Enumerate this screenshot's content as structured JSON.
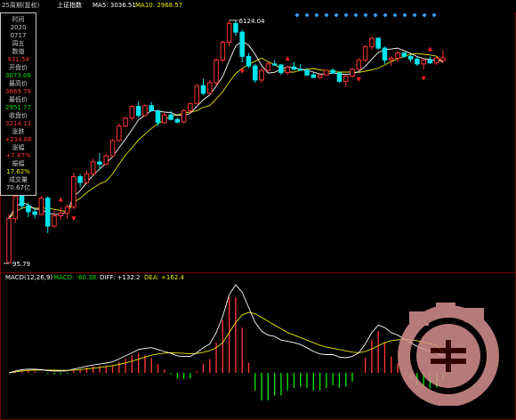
{
  "header": {
    "period": "25周期(复权)",
    "index_name": "上证指数",
    "ma5": "MA5: 3036.51",
    "ma10": "MA10: 2968.57"
  },
  "panel": {
    "time_label": "时间",
    "year": "2020",
    "date": "0717",
    "weekday": "周五",
    "value_label": "数值",
    "value": "931.54",
    "open_label": "开盘价",
    "open": "3073.08",
    "high_label": "最高价",
    "high": "3669.79",
    "low_label": "最低价",
    "low": "2951.77",
    "close_label": "收盘价",
    "close": "3214.13",
    "change_label": "涨跌",
    "change": "+234.88",
    "change_pct_label": "涨幅",
    "change_pct": "+7.87%",
    "amplitude_label": "振幅",
    "amplitude": "17.62%",
    "volume_label": "成交量",
    "volume": "70.67亿"
  },
  "macd": {
    "title": "MACD(12,26,9)",
    "macd": "MACD: -60.38",
    "diff": "DIFF: +132.2",
    "dea": "DEA: +162.4"
  },
  "annotations": {
    "high_label": "6124.04",
    "low_label": "95.79"
  },
  "colors": {
    "up": "#ff3232",
    "down": "#00e5ee",
    "ma5": "#ffffff",
    "ma10": "#e8e800",
    "diff": "#ffffff",
    "dea": "#e8e800",
    "hist_pos": "#ff3232",
    "hist_neg": "#00e000"
  },
  "chart_data": {
    "type": "candlestick",
    "price_range": [
      95,
      6200
    ],
    "ohlc": [
      [
        96,
        220,
        95,
        205
      ],
      [
        205,
        320,
        190,
        300
      ],
      [
        300,
        335,
        240,
        255
      ],
      [
        255,
        270,
        210,
        230
      ],
      [
        230,
        245,
        205,
        220
      ],
      [
        220,
        300,
        215,
        290
      ],
      [
        290,
        300,
        160,
        180
      ],
      [
        180,
        235,
        175,
        215
      ],
      [
        215,
        250,
        200,
        225
      ],
      [
        225,
        260,
        205,
        250
      ],
      [
        250,
        450,
        240,
        420
      ],
      [
        420,
        440,
        350,
        380
      ],
      [
        380,
        470,
        370,
        440
      ],
      [
        440,
        570,
        430,
        540
      ],
      [
        540,
        630,
        480,
        520
      ],
      [
        520,
        620,
        510,
        600
      ],
      [
        600,
        800,
        590,
        780
      ],
      [
        780,
        1050,
        760,
        1000
      ],
      [
        1000,
        1160,
        980,
        1150
      ],
      [
        1150,
        1430,
        1100,
        1400
      ],
      [
        1400,
        1520,
        1150,
        1200
      ],
      [
        1200,
        1450,
        1180,
        1420
      ],
      [
        1420,
        1510,
        1280,
        1300
      ],
      [
        1300,
        1330,
        1000,
        1060
      ],
      [
        1060,
        1250,
        1040,
        1210
      ],
      [
        1210,
        1300,
        1100,
        1120
      ],
      [
        1120,
        1150,
        1050,
        1070
      ],
      [
        1070,
        1340,
        1050,
        1300
      ],
      [
        1300,
        1480,
        1240,
        1470
      ],
      [
        1470,
        2050,
        1450,
        2000
      ],
      [
        2000,
        2250,
        1700,
        1750
      ],
      [
        1750,
        2200,
        1700,
        2100
      ],
      [
        2100,
        3200,
        2000,
        3100
      ],
      [
        3100,
        4300,
        3000,
        4200
      ],
      [
        4200,
        6124,
        3900,
        5800
      ],
      [
        5800,
        6100,
        4700,
        5000
      ],
      [
        5000,
        5200,
        2990,
        3300
      ],
      [
        3300,
        3500,
        2700,
        2800
      ],
      [
        2800,
        2900,
        2100,
        2200
      ],
      [
        2200,
        2700,
        2100,
        2600
      ],
      [
        2600,
        3000,
        2550,
        2900
      ],
      [
        2900,
        3100,
        2800,
        2850
      ],
      [
        2850,
        2900,
        2400,
        2500
      ],
      [
        2500,
        2800,
        2400,
        2750
      ],
      [
        2750,
        3000,
        2600,
        2650
      ],
      [
        2650,
        2900,
        2580,
        2600
      ],
      [
        2600,
        2700,
        2350,
        2400
      ],
      [
        2400,
        2500,
        2280,
        2300
      ],
      [
        2300,
        2450,
        2250,
        2400
      ],
      [
        2400,
        2650,
        2380,
        2600
      ],
      [
        2600,
        2700,
        2450,
        2480
      ],
      [
        2480,
        2550,
        2100,
        2150
      ],
      [
        2150,
        2400,
        1950,
        2350
      ],
      [
        2350,
        2700,
        2300,
        2650
      ],
      [
        2650,
        3200,
        2600,
        3100
      ],
      [
        3100,
        4000,
        3000,
        3900
      ],
      [
        3900,
        4600,
        3700,
        4500
      ],
      [
        4500,
        4600,
        3700,
        3800
      ],
      [
        3800,
        3900,
        2900,
        3100
      ],
      [
        3100,
        3300,
        2800,
        3200
      ],
      [
        3200,
        3600,
        3000,
        3500
      ],
      [
        3500,
        3550,
        3200,
        3300
      ],
      [
        3300,
        3400,
        3000,
        3150
      ],
      [
        3150,
        3300,
        2800,
        2900
      ],
      [
        2900,
        3200,
        2650,
        3100
      ],
      [
        3100,
        3300,
        2900,
        2950
      ],
      [
        2950,
        3250,
        2850,
        3200
      ],
      [
        3073,
        3670,
        2952,
        3214
      ]
    ],
    "ma5": [
      205,
      250,
      270,
      260,
      240,
      240,
      225,
      220,
      220,
      230,
      300,
      330,
      380,
      430,
      480,
      530,
      590,
      690,
      800,
      940,
      1110,
      1210,
      1300,
      1290,
      1270,
      1260,
      1200,
      1200,
      1240,
      1400,
      1570,
      1700,
      1990,
      2340,
      3060,
      3940,
      4280,
      4000,
      3420,
      2820,
      2480,
      2510,
      2650,
      2770,
      2700,
      2650,
      2610,
      2520,
      2440,
      2440,
      2480,
      2450,
      2420,
      2450,
      2540,
      2780,
      3150,
      3520,
      3700,
      3740,
      3800,
      3640,
      3480,
      3290,
      3180,
      3120,
      3090,
      3030
    ],
    "ma10": [
      205,
      230,
      245,
      250,
      245,
      245,
      245,
      240,
      235,
      230,
      270,
      290,
      320,
      345,
      370,
      390,
      440,
      520,
      610,
      690,
      790,
      870,
      960,
      1040,
      1110,
      1190,
      1210,
      1250,
      1270,
      1300,
      1380,
      1420,
      1590,
      1800,
      2130,
      2460,
      2680,
      2870,
      3040,
      3210,
      3010,
      2860,
      2670,
      2520,
      2520,
      2600,
      2650,
      2680,
      2620,
      2570,
      2540,
      2520,
      2520,
      2520,
      2510,
      2560,
      2620,
      2700,
      2850,
      3020,
      3170,
      3300,
      3420,
      3470,
      3420,
      3380,
      3310,
      2969
    ],
    "diff": [
      0,
      15,
      25,
      30,
      28,
      25,
      18,
      15,
      14,
      16,
      30,
      40,
      52,
      62,
      70,
      78,
      88,
      110,
      135,
      160,
      185,
      195,
      200,
      185,
      170,
      155,
      135,
      130,
      130,
      160,
      200,
      230,
      320,
      450,
      620,
      700,
      640,
      520,
      400,
      330,
      300,
      290,
      260,
      250,
      240,
      225,
      200,
      170,
      150,
      145,
      145,
      125,
      120,
      130,
      160,
      230,
      320,
      380,
      360,
      320,
      300,
      270,
      240,
      210,
      190,
      170,
      160,
      132
    ],
    "dea": [
      0,
      8,
      15,
      20,
      22,
      23,
      22,
      21,
      20,
      20,
      22,
      26,
      31,
      37,
      43,
      50,
      57,
      67,
      79,
      92,
      108,
      125,
      140,
      150,
      157,
      160,
      158,
      155,
      152,
      154,
      163,
      176,
      200,
      240,
      320,
      400,
      460,
      480,
      470,
      440,
      410,
      380,
      350,
      320,
      300,
      280,
      260,
      240,
      220,
      205,
      195,
      185,
      175,
      165,
      160,
      170,
      190,
      215,
      240,
      255,
      262,
      265,
      262,
      255,
      245,
      232,
      218,
      162
    ],
    "hist": [
      0,
      14,
      20,
      20,
      12,
      4,
      -8,
      -12,
      -12,
      -8,
      16,
      28,
      42,
      50,
      54,
      56,
      62,
      86,
      112,
      136,
      154,
      140,
      120,
      70,
      26,
      -10,
      -46,
      -50,
      -44,
      12,
      74,
      108,
      240,
      420,
      600,
      600,
      360,
      80,
      -140,
      -220,
      -220,
      -180,
      -180,
      -140,
      -120,
      -110,
      -120,
      -140,
      -140,
      -120,
      -100,
      -120,
      -110,
      -70,
      0,
      120,
      260,
      330,
      240,
      130,
      76,
      10,
      -44,
      -90,
      -110,
      -124,
      -116,
      -60
    ],
    "buy_signals": [
      10,
      36,
      54,
      64
    ],
    "sell_signals": [
      8,
      43,
      65
    ]
  }
}
